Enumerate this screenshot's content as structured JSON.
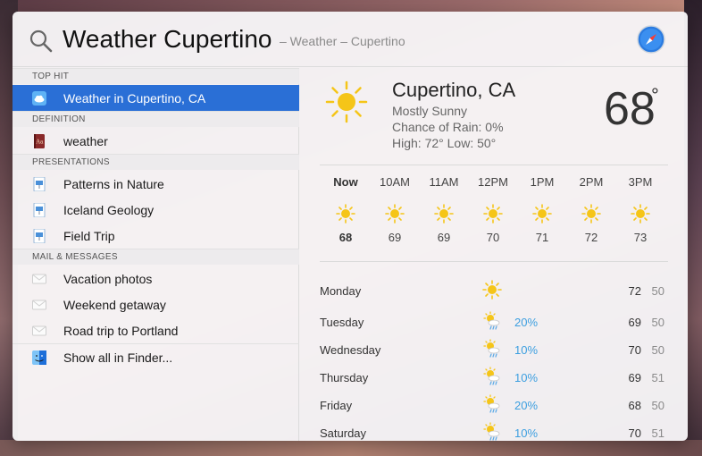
{
  "search": {
    "query": "Weather Cupertino",
    "hint": "– Weather – Cupertino"
  },
  "sections": {
    "top_hit": "TOP HIT",
    "definition": "DEFINITION",
    "presentations": "PRESENTATIONS",
    "mail": "MAIL & MESSAGES"
  },
  "results": {
    "top_hit": {
      "label": "Weather in Cupertino, CA",
      "icon": "cloud-icon"
    },
    "definition": {
      "label": "weather",
      "icon": "dictionary-icon"
    },
    "presentations": [
      {
        "label": "Patterns in Nature",
        "icon": "keynote-doc-icon"
      },
      {
        "label": "Iceland Geology",
        "icon": "keynote-doc-icon"
      },
      {
        "label": "Field Trip",
        "icon": "keynote-doc-icon"
      }
    ],
    "mail": [
      {
        "label": "Vacation photos",
        "icon": "envelope-icon"
      },
      {
        "label": "Weekend getaway",
        "icon": "envelope-icon"
      },
      {
        "label": "Road trip to Portland",
        "icon": "envelope-icon"
      }
    ],
    "show_all": {
      "label": "Show all in Finder...",
      "icon": "finder-icon"
    }
  },
  "weather": {
    "city": "Cupertino, CA",
    "condition": "Mostly Sunny",
    "rain": "Chance of Rain: 0%",
    "highlow": "High: 72°  Low: 50°",
    "current_temp": "68",
    "degree": "°",
    "hourly": [
      {
        "label": "Now",
        "temp": "68"
      },
      {
        "label": "10AM",
        "temp": "69"
      },
      {
        "label": "11AM",
        "temp": "69"
      },
      {
        "label": "12PM",
        "temp": "70"
      },
      {
        "label": "1PM",
        "temp": "71"
      },
      {
        "label": "2PM",
        "temp": "72"
      },
      {
        "label": "3PM",
        "temp": "73"
      }
    ],
    "daily": [
      {
        "day": "Monday",
        "icon": "sun-icon",
        "rain": "",
        "high": "72",
        "low": "50"
      },
      {
        "day": "Tuesday",
        "icon": "sun-rain-icon",
        "rain": "20%",
        "high": "69",
        "low": "50"
      },
      {
        "day": "Wednesday",
        "icon": "sun-rain-icon",
        "rain": "10%",
        "high": "70",
        "low": "50"
      },
      {
        "day": "Thursday",
        "icon": "sun-rain-icon",
        "rain": "10%",
        "high": "69",
        "low": "51"
      },
      {
        "day": "Friday",
        "icon": "sun-rain-icon",
        "rain": "20%",
        "high": "68",
        "low": "50"
      },
      {
        "day": "Saturday",
        "icon": "sun-rain-icon",
        "rain": "10%",
        "high": "70",
        "low": "51"
      }
    ]
  },
  "colors": {
    "selection": "#2a6fd6",
    "rain": "#3d9fe0",
    "sun": "#f5c518"
  }
}
